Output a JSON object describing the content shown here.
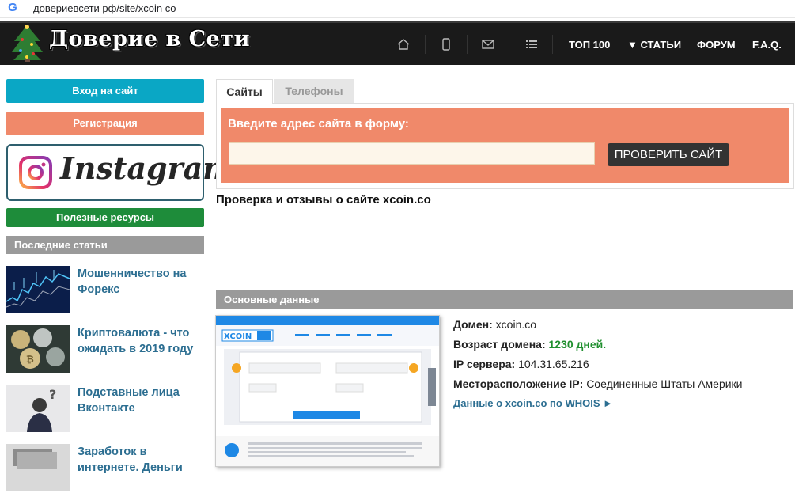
{
  "browser": {
    "url": "довериевсети рф/site/xcoin co"
  },
  "header": {
    "site_title": "Доверие в Сети",
    "icons": [
      "home-icon",
      "mobile-icon",
      "mail-icon",
      "list-icon"
    ],
    "nav": {
      "top100": "ТОП 100",
      "articles": "▼ СТАТЬИ",
      "forum": "ФОРУМ",
      "faq": "F.A.Q."
    }
  },
  "sidebar": {
    "login": "Вход на сайт",
    "register": "Регистрация",
    "instagram": "Instagram",
    "resources": "Полезные ресурсы",
    "recent_heading": "Последние статьи",
    "articles": [
      {
        "title": "Мошенничество на Форекс"
      },
      {
        "title": "Криптовалюта - что ожидать в 2019 году"
      },
      {
        "title": "Подставные лица Вконтакте"
      },
      {
        "title": "Заработок в интернете. Деньги"
      }
    ]
  },
  "main": {
    "tabs": [
      "Сайты",
      "Телефоны"
    ],
    "form_label": "Введите адрес сайта в форму:",
    "input_value": "",
    "check_button": "ПРОВЕРИТЬ САЙТ",
    "page_heading": "Проверка и отзывы о сайте xcoin.co",
    "section_heading": "Основные данные",
    "info": {
      "domain_label": "Домен:",
      "domain_value": "xcoin.co",
      "age_label": "Возраст домена:",
      "age_value": "1230 дней.",
      "ip_label": "IP сервера:",
      "ip_value": "104.31.65.216",
      "location_label": "Месторасположение IP:",
      "location_value": "Соединенные Штаты Америки",
      "whois_link": "Данные о xcoin.co по WHOIS ►"
    }
  },
  "colors": {
    "header_bg": "#1a1a1a",
    "login_btn": "#0aa7c5",
    "accent_orange": "#f0896a",
    "resources_btn": "#1e8c3a",
    "link_blue": "#2c6e91",
    "section_gray": "#9a9a9a",
    "age_green": "#1f8f2e"
  }
}
